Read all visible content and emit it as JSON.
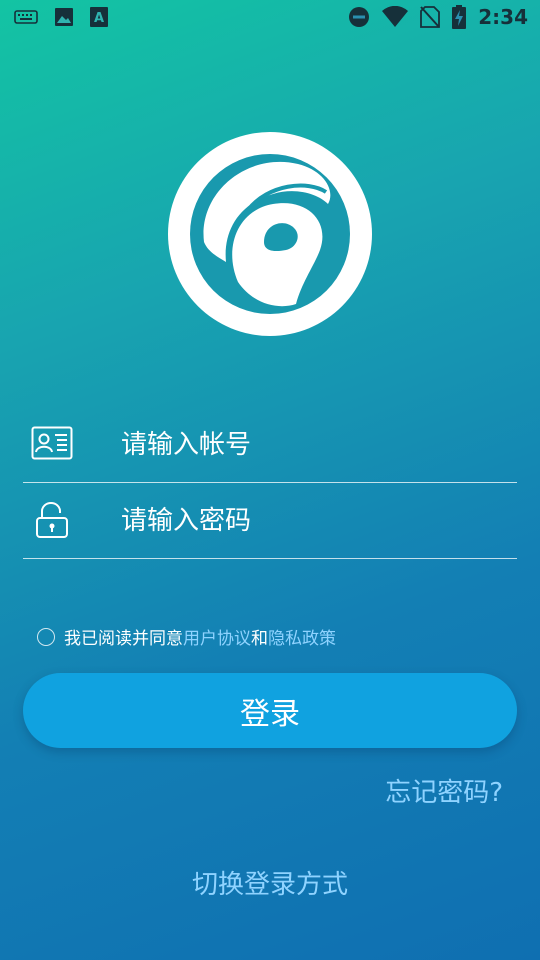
{
  "status_bar": {
    "time": "2:34",
    "left_icons": [
      "keyboard-icon",
      "image-icon",
      "text-a-icon"
    ],
    "right_icons": [
      "do-not-disturb-icon",
      "wifi-icon",
      "no-sim-icon",
      "battery-charging-icon"
    ]
  },
  "logo": {
    "icon": "brand-logo-icon"
  },
  "account_field": {
    "icon": "id-card-icon",
    "placeholder": "请输入帐号",
    "value": ""
  },
  "password_field": {
    "icon": "lock-icon",
    "placeholder": "请输入密码",
    "value": ""
  },
  "agreement": {
    "checked": false,
    "prefix": "我已阅读并同意",
    "user_agreement": "用户协议",
    "and": "和",
    "privacy_policy": "隐私政策"
  },
  "login_button": {
    "label": "登录"
  },
  "forgot_password": "忘记密码?",
  "switch_login": "切换登录方式",
  "colors": {
    "accent_button": "#10a2e0",
    "link": "#8fd3ff",
    "gradient_start": "#13c4a3",
    "gradient_end": "#0f6fb1"
  }
}
